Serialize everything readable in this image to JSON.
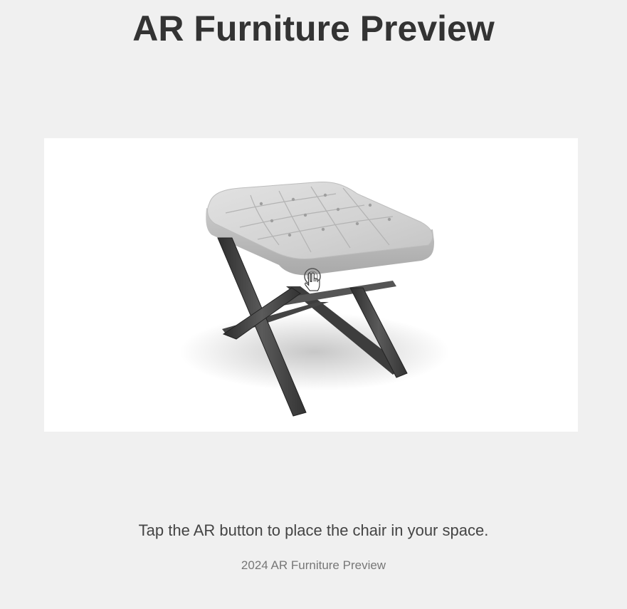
{
  "page": {
    "title": "AR Furniture Preview",
    "instruction": "Tap the AR button to place the chair in your space.",
    "footer": "2024 AR Furniture Preview"
  },
  "viewer": {
    "model": "tufted-ottoman-with-x-legs",
    "cursor_icon": "hand-pointer-icon"
  },
  "colors": {
    "background": "#f0f0f0",
    "viewer_background": "#ffffff",
    "title": "#333333",
    "instruction": "#444444",
    "footer": "#777777",
    "cushion": "#d9d9d9",
    "legs": "#4a4a4a"
  }
}
